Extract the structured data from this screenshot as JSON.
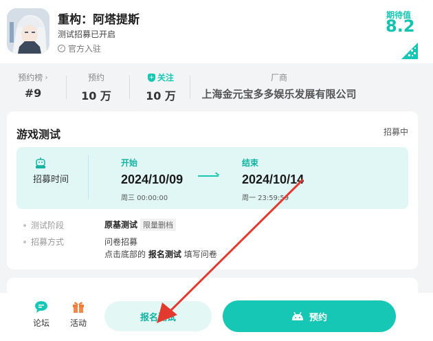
{
  "app": {
    "title": "重构：阿塔提斯",
    "subtitle": "测试招募已开启",
    "official": "官方入驻",
    "expect_label": "期待值",
    "expect_value": "8.2"
  },
  "stats": [
    {
      "label": "预约榜",
      "value": "#9"
    },
    {
      "label": "预约",
      "value": "10 万"
    },
    {
      "label": "关注",
      "value": "10 万"
    },
    {
      "label": "厂商",
      "value": "上海金元宝多多娱乐发展有限公司"
    }
  ],
  "test_card": {
    "title": "游戏测试",
    "status": "招募中",
    "recruit_label": "招募时间",
    "start_label": "开始",
    "start_date": "2024/10/09",
    "start_sub": "周三 00:00:00",
    "end_label": "结束",
    "end_date": "2024/10/14",
    "end_sub": "周一 23:59:59",
    "stage_label": "测试阶段",
    "stage_value": "原基测试",
    "stage_chip": "限量删档",
    "method_label": "招募方式",
    "method_line1": "问卷招募",
    "method_line2_prefix": "点击底部的",
    "method_line2_bold": "报名测试",
    "method_line2_suffix": "填写问卷"
  },
  "bottom_bar": {
    "forum": "论坛",
    "activity": "活动",
    "signup": "报名测试",
    "reserve": "预约"
  },
  "colors": {
    "accent": "#16c7b5",
    "accent_light": "#e1f7f5",
    "annotation_arrow": "#e23a2e"
  }
}
